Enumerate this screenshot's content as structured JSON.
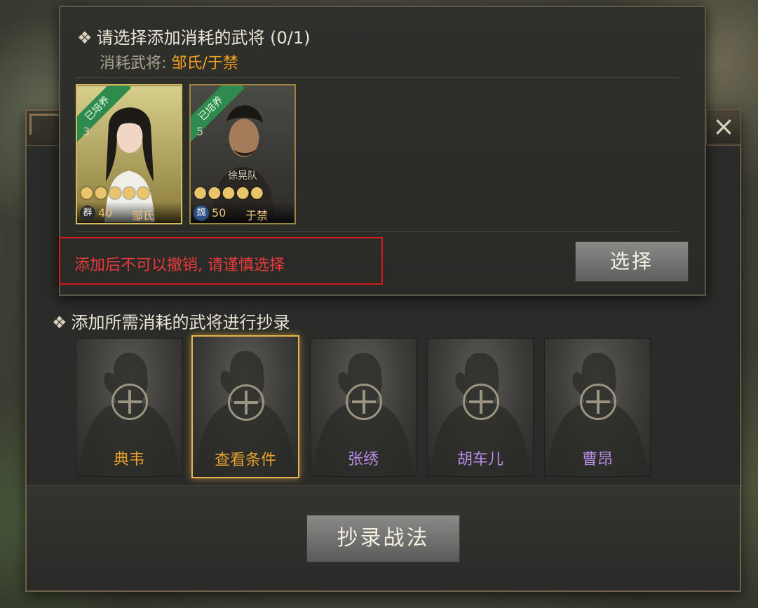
{
  "popup": {
    "title": "请选择添加消耗的武将 (0/1)",
    "subtitle_prefix": "消耗武将: ",
    "subtitle_names": "邹氏/于禁",
    "warning": "添加后不可以撤销, 请谨慎选择",
    "select_label": "选择",
    "heroes": [
      {
        "ribbon": "已培养",
        "level": "3",
        "faction": "群",
        "cost": "40",
        "name": "邹氏",
        "stars": 5,
        "selected": true,
        "troop": ""
      },
      {
        "ribbon": "已培养",
        "level": "5",
        "faction": "魏",
        "cost": "50",
        "name": "于禁",
        "stars": 5,
        "selected": false,
        "troop": "徐晃队"
      }
    ]
  },
  "section": {
    "title": "添加所需消耗的武将进行抄录",
    "slots": [
      {
        "label": "典韦",
        "color": "#e8a12e"
      },
      {
        "label": "查看条件",
        "color": "#e8a12e"
      },
      {
        "label": "张绣",
        "color": "#b98ce8"
      },
      {
        "label": "胡车儿",
        "color": "#b98ce8"
      },
      {
        "label": "曹昂",
        "color": "#b98ce8"
      }
    ]
  },
  "copy_button": "抄录战法",
  "close_icon": "×",
  "bullet": "❖",
  "star_glyph": "●"
}
